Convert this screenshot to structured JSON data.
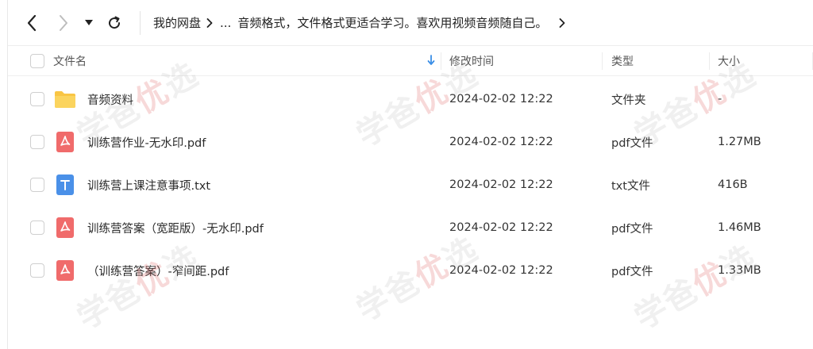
{
  "nav": {
    "breadcrumb_root": "我的网盘",
    "breadcrumb_ellipsis": "...",
    "breadcrumb_current": "音频格式，文件格式更适合学习。喜欢用视频音频随自己。"
  },
  "table": {
    "headers": {
      "name": "文件名",
      "modified": "修改时间",
      "type": "类型",
      "size": "大小"
    },
    "rows": [
      {
        "name": "音频资料",
        "modified": "2024-02-02 12:22",
        "type": "文件夹",
        "size": "-",
        "icon": "folder-icon"
      },
      {
        "name": "训练营作业-无水印.pdf",
        "modified": "2024-02-02 12:22",
        "type": "pdf文件",
        "size": "1.27MB",
        "icon": "pdf-icon"
      },
      {
        "name": "训练营上课注意事项.txt",
        "modified": "2024-02-02 12:22",
        "type": "txt文件",
        "size": "416B",
        "icon": "txt-icon"
      },
      {
        "name": "训练营答案（宽距版）-无水印.pdf",
        "modified": "2024-02-02 12:22",
        "type": "pdf文件",
        "size": "1.46MB",
        "icon": "pdf-icon"
      },
      {
        "name": "（训练营答案）-窄间距.pdf",
        "modified": "2024-02-02 12:22",
        "type": "pdf文件",
        "size": "1.33MB",
        "icon": "pdf-icon"
      }
    ]
  },
  "watermark": {
    "text_a": "学爸",
    "text_b": "优",
    "text_c": "选"
  },
  "colors": {
    "folder": "#f9c544",
    "pdf": "#f06b6b",
    "txt": "#4a90e8",
    "sort_arrow": "#3a8ee6"
  }
}
